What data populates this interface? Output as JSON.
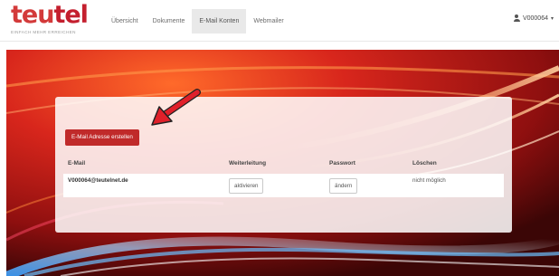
{
  "brand": {
    "logo_part1": "teu",
    "logo_part2": "tel",
    "tagline": "EINFACH MEHR ERREICHEN"
  },
  "nav": {
    "items": [
      {
        "label": "Übersicht",
        "active": false
      },
      {
        "label": "Dokumente",
        "active": false
      },
      {
        "label": "E-Mail Konten",
        "active": true
      },
      {
        "label": "Webmailer",
        "active": false
      }
    ]
  },
  "user": {
    "name": "V000064",
    "icon": "user-icon"
  },
  "main": {
    "create_button": "E-Mail Adresse erstellen",
    "table": {
      "headers": {
        "email": "E-Mail",
        "forwarding": "Weiterleitung",
        "password": "Passwort",
        "delete": "Löschen"
      },
      "rows": [
        {
          "email": "V000064@teutelnet.de",
          "forwarding_button": "aktivieren",
          "password_button": "ändern",
          "delete_status": "nicht möglich"
        }
      ]
    }
  },
  "colors": {
    "brand_red": "#c41f2e",
    "button_red": "#c02a2a",
    "active_tab": "#e9e9e9"
  }
}
